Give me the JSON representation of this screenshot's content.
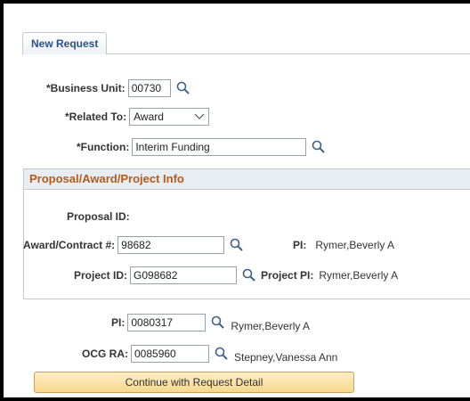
{
  "tabs": {
    "new_request": "New Request"
  },
  "form": {
    "business_unit": {
      "label": "*Business Unit:",
      "value": "00730"
    },
    "related_to": {
      "label": "*Related To:",
      "value": "Award"
    },
    "function": {
      "label": "*Function:",
      "value": "Interim Funding"
    }
  },
  "group": {
    "title": "Proposal/Award/Project Info",
    "proposal_id": {
      "label": "Proposal ID:"
    },
    "award_contract": {
      "label": "Award/Contract #:",
      "value": "98682"
    },
    "pi": {
      "label": "PI:",
      "value": "Rymer,Beverly A"
    },
    "project_id": {
      "label": "Project ID:",
      "value": "G098682"
    },
    "project_pi": {
      "label": "Project PI:",
      "value": "Rymer,Beverly A"
    }
  },
  "lower": {
    "pi": {
      "label": "PI:",
      "value": "0080317",
      "name": "Rymer,Beverly A"
    },
    "ocg_ra": {
      "label": "OCG RA:",
      "value": "0085960",
      "name": "Stepney,Vanessa Ann"
    }
  },
  "buttons": {
    "continue": "Continue with Request Detail"
  },
  "colors": {
    "tab_text": "#2b4f8c",
    "group_title": "#b85a17",
    "button_bg": "#f8d78c"
  }
}
